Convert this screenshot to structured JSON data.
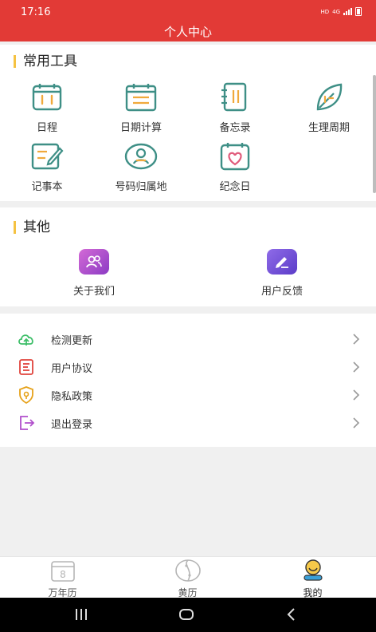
{
  "status_bar": {
    "time": "17:16",
    "network_hd": "HD",
    "network_4g": "4G"
  },
  "header": {
    "title": "个人中心"
  },
  "tools": {
    "title": "常用工具",
    "items": [
      {
        "label": "日程",
        "icon": "schedule-icon"
      },
      {
        "label": "日期计算",
        "icon": "date-calc-icon"
      },
      {
        "label": "备忘录",
        "icon": "memo-icon"
      },
      {
        "label": "生理周期",
        "icon": "leaf-icon"
      },
      {
        "label": "记事本",
        "icon": "notebook-icon"
      },
      {
        "label": "号码归属地",
        "icon": "location-icon"
      },
      {
        "label": "纪念日",
        "icon": "anniversary-icon"
      }
    ]
  },
  "other": {
    "title": "其他",
    "items": [
      {
        "label": "关于我们",
        "icon": "about-us-icon",
        "color": "#b64fc8"
      },
      {
        "label": "用户反馈",
        "icon": "feedback-icon",
        "color": "#7a55d6"
      }
    ]
  },
  "menu": [
    {
      "label": "检测更新",
      "icon": "cloud-upload-icon",
      "color": "#3fbf6a"
    },
    {
      "label": "用户协议",
      "icon": "agreement-icon",
      "color": "#e0443c"
    },
    {
      "label": "隐私政策",
      "icon": "privacy-shield-icon",
      "color": "#e6a21a"
    },
    {
      "label": "退出登录",
      "icon": "logout-icon",
      "color": "#b04fcb"
    }
  ],
  "tabbar": [
    {
      "label": "万年历",
      "icon": "calendar-tab-icon",
      "badge": "8",
      "active": false
    },
    {
      "label": "黄历",
      "icon": "yinyang-tab-icon",
      "active": false
    },
    {
      "label": "我的",
      "icon": "profile-tab-icon",
      "active": true
    }
  ],
  "colors": {
    "header": "#e23a36",
    "accent_bar": "#f5c242",
    "tool_icon": "#3e8f86"
  }
}
